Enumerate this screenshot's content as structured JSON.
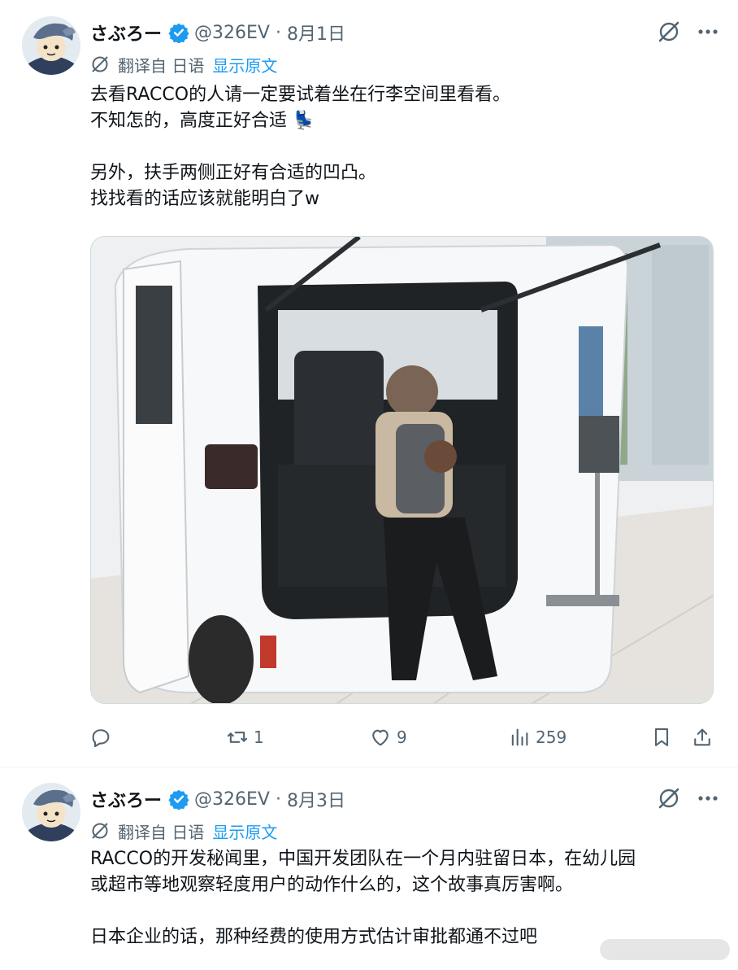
{
  "colors": {
    "accent": "#1d9bf0",
    "muted": "#536471",
    "text": "#0f1419"
  },
  "tweets": [
    {
      "author": {
        "name": "さぶろー",
        "handle": "@326EV",
        "verified": true
      },
      "date": "8月1日",
      "translate": {
        "label": "翻译自 日语",
        "show_original": "显示原文"
      },
      "lines": [
        "去看RACCO的人请一定要试着坐在行李空间里看看。",
        "不知怎的，高度正好合适 💺",
        "",
        "另外，扶手两侧正好有合适的凹凸。",
        "找找看的话应该就能明白了w"
      ],
      "media": {
        "icon": "photo",
        "description": ""
      },
      "actions": {
        "reply": "",
        "retweet": "1",
        "like": "9",
        "views": "259"
      }
    },
    {
      "author": {
        "name": "さぶろー",
        "handle": "@326EV",
        "verified": true
      },
      "date": "8月3日",
      "translate": {
        "label": "翻译自 日语",
        "show_original": "显示原文"
      },
      "lines": [
        "RACCO的开发秘闻里，中国开发团队在一个月内驻留日本，在幼儿园",
        "或超市等地观察轻度用户的动作什么的，这个故事真厉害啊。",
        "",
        "日本企业的话，那种经费的使用方式估计审批都通不过吧"
      ]
    }
  ]
}
